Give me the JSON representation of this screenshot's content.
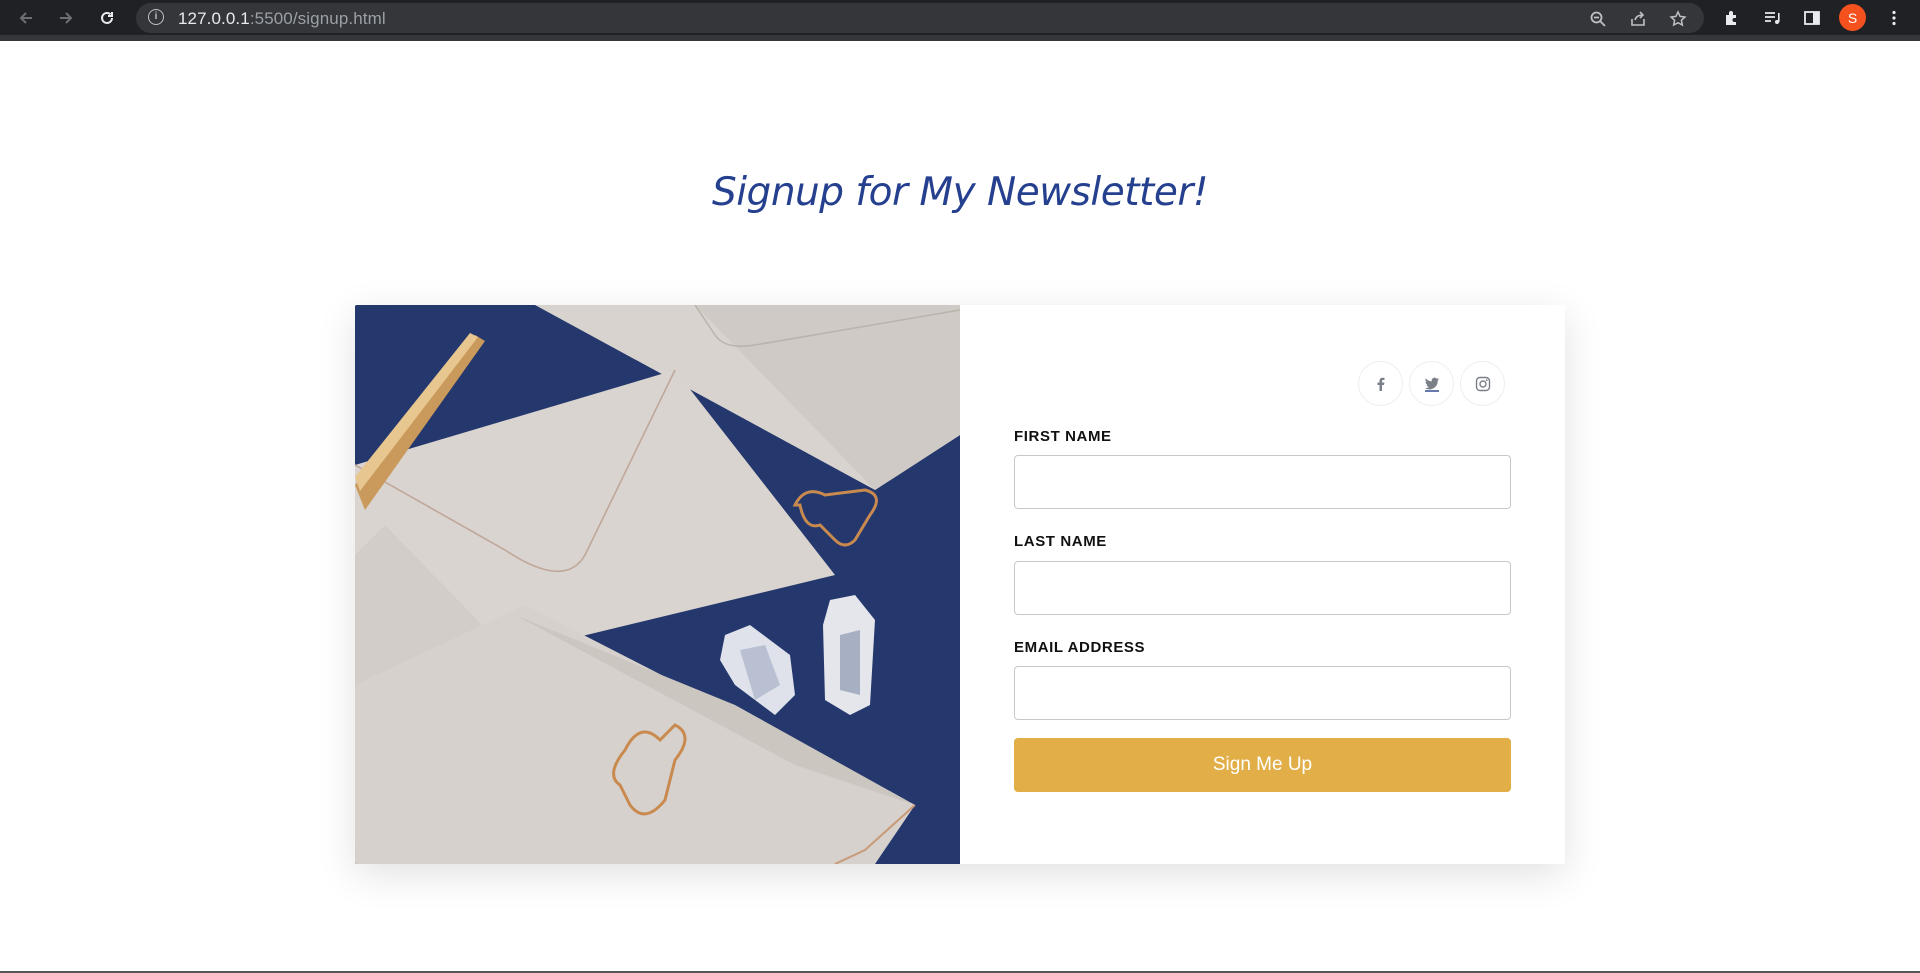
{
  "browser": {
    "url_host": "127.0.0.1",
    "url_rest": ":5500/signup.html",
    "profile_initial": "S",
    "icons": [
      "back-icon",
      "forward-icon",
      "reload-icon",
      "site-info-icon",
      "zoom-icon",
      "share-icon",
      "bookmark-star-icon",
      "extensions-icon",
      "media-icon",
      "side-panel-icon",
      "menu-icon"
    ]
  },
  "page": {
    "title": "Signup for My Newsletter!"
  },
  "social": [
    {
      "name": "facebook",
      "glyph": "f"
    },
    {
      "name": "twitter",
      "glyph": "t"
    },
    {
      "name": "instagram",
      "glyph": "ig"
    }
  ],
  "form": {
    "first_name_label": "FIRST NAME",
    "first_name_value": "",
    "last_name_label": "LAST NAME",
    "last_name_value": "",
    "email_label": "EMAIL ADDRESS",
    "email_value": "",
    "submit_label": "Sign Me Up"
  },
  "colors": {
    "title": "#25408f",
    "button": "#e2ae48",
    "photo_background": "#25386d"
  }
}
